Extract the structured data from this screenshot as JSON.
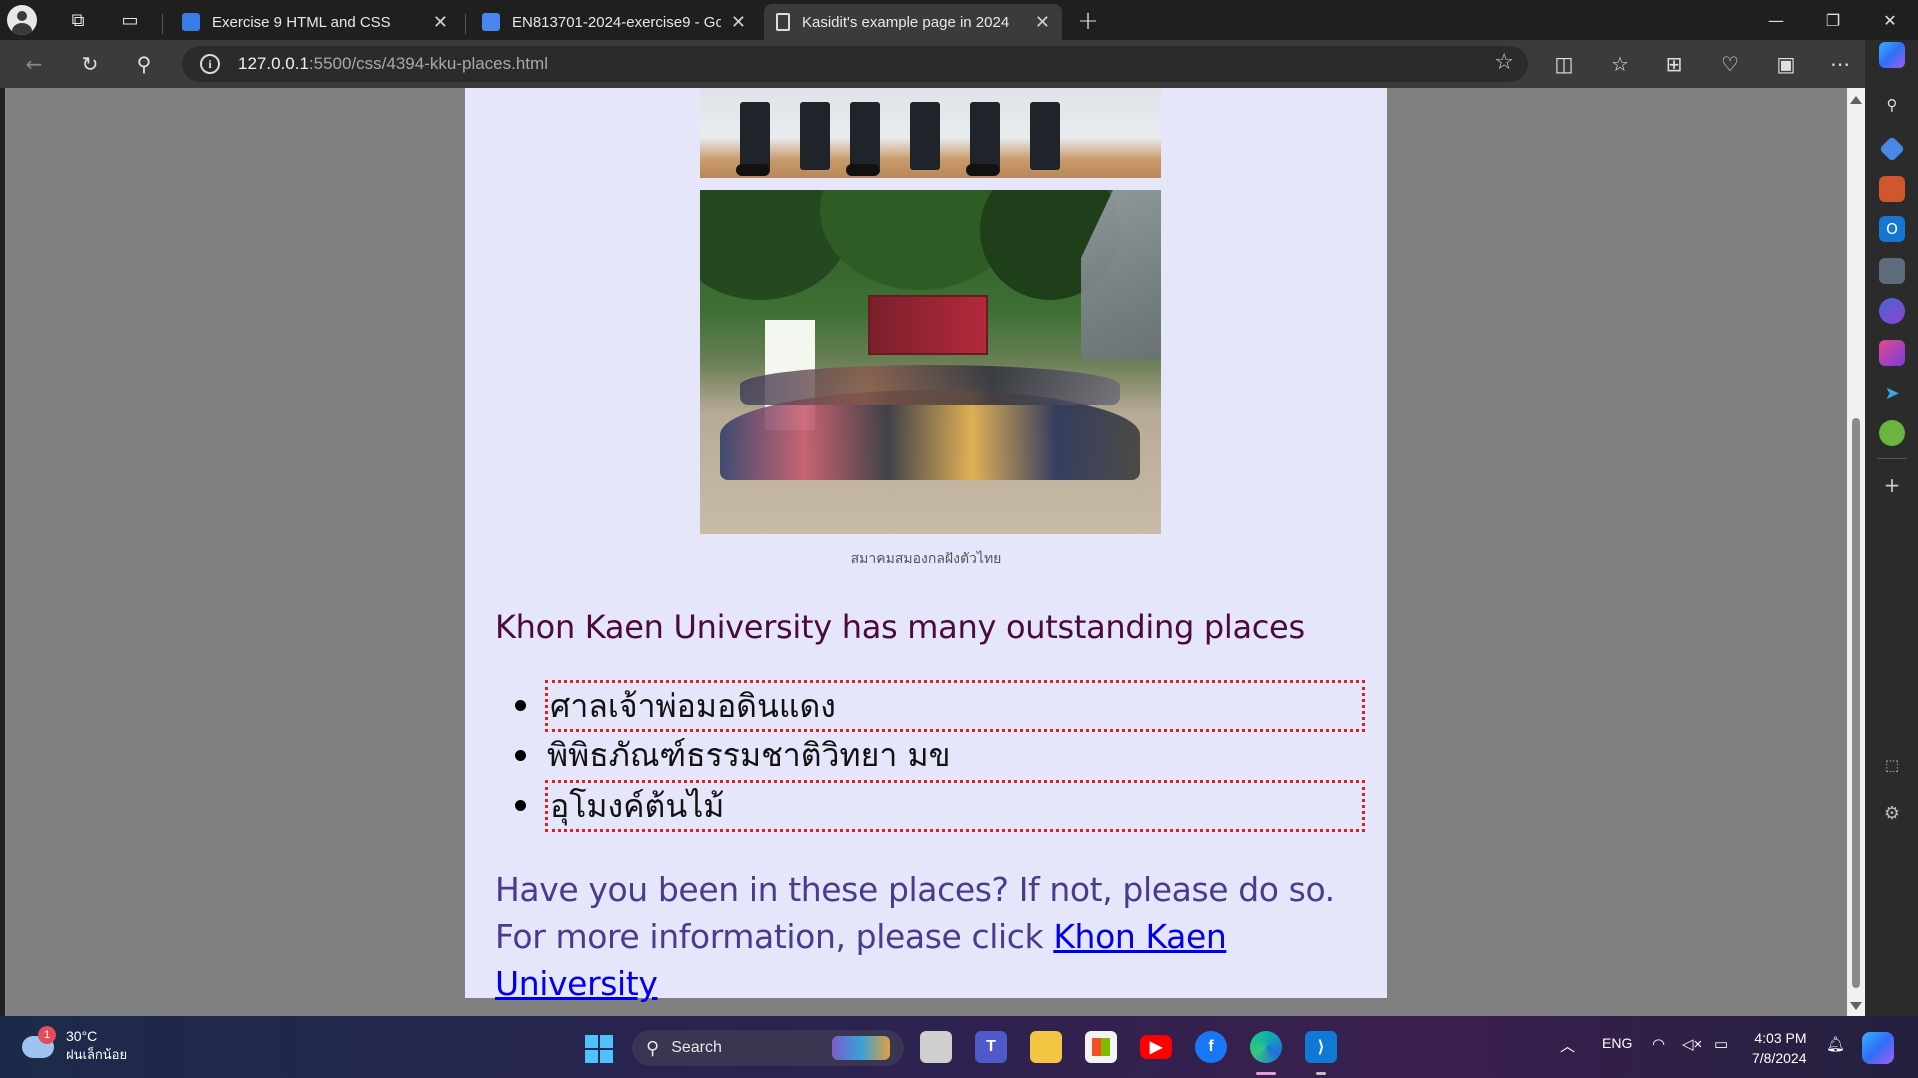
{
  "browser": {
    "tabs": [
      {
        "title": "Exercise 9 HTML and CSS",
        "icon": "classroom-icon",
        "color": "#3b7be8"
      },
      {
        "title": "EN813701-2024-exercise9 - Goo",
        "icon": "docs-icon",
        "color": "#4a86f0"
      },
      {
        "title": "Kasidit's example page in 2024",
        "icon": "page-icon",
        "color": "#dddddd"
      }
    ],
    "url_host": "127.0.0.1",
    "url_path": ":5500/css/4394-kku-places.html"
  },
  "page": {
    "caption": "สมาคมสมองกลฝังตัวไทย",
    "heading": "Khon Kaen University has many outstanding places",
    "places": [
      {
        "label": "ศาลเจ้าพ่อมอดินแดง",
        "boxed": true
      },
      {
        "label": "พิพิธภัณฑ์ธรรมชาติวิทยา มข",
        "boxed": false
      },
      {
        "label": "อุโมงค์ต้นไม้",
        "boxed": true
      }
    ],
    "closing_text": "Have you been in these places? If not, please do so. For more information, please click ",
    "link_text": "Khon Kaen University",
    "colors": {
      "page_bg": "#e6e6fa",
      "heading": "#4b0a3d",
      "closing": "#4a3c8c",
      "link": "#0000ee",
      "box_border": "#e02020"
    }
  },
  "taskbar": {
    "weather_temp": "30°C",
    "weather_desc": "ฝนเล็กน้อย",
    "weather_badge": "1",
    "search_label": "Search",
    "language": "ENG",
    "time": "4:03 PM",
    "date": "7/8/2024"
  }
}
